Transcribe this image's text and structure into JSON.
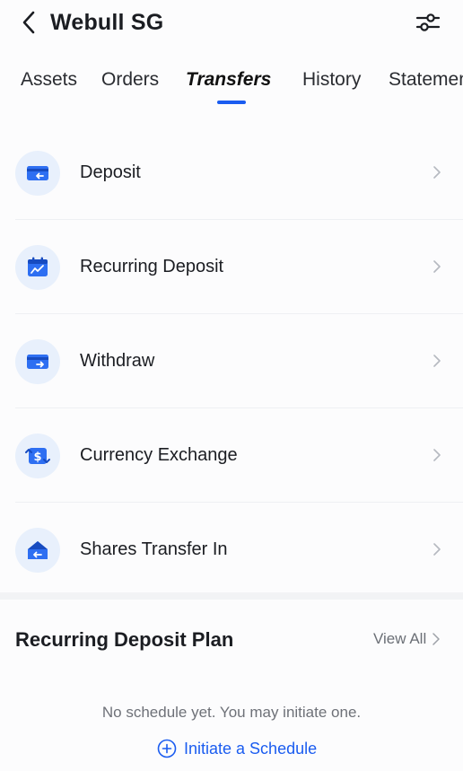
{
  "header": {
    "title": "Webull SG",
    "back_icon": "chevron-left-icon",
    "filter_icon": "sliders-icon"
  },
  "tabs": [
    {
      "label": "Assets",
      "active": false
    },
    {
      "label": "Orders",
      "active": false
    },
    {
      "label": "Transfers",
      "active": true
    },
    {
      "label": "History",
      "active": false
    },
    {
      "label": "Statements",
      "active": false
    }
  ],
  "transfer_items": [
    {
      "label": "Deposit",
      "icon": "deposit-card-icon"
    },
    {
      "label": "Recurring Deposit",
      "icon": "calendar-chart-icon"
    },
    {
      "label": "Withdraw",
      "icon": "withdraw-card-icon"
    },
    {
      "label": "Currency Exchange",
      "icon": "currency-exchange-icon"
    },
    {
      "label": "Shares Transfer In",
      "icon": "house-transfer-icon"
    }
  ],
  "recurring_plan": {
    "title": "Recurring Deposit Plan",
    "view_all": "View All",
    "empty_text": "No schedule yet. You may initiate one.",
    "initiate_label": "Initiate a Schedule"
  },
  "colors": {
    "accent": "#1a5cf0",
    "icon_bg": "#e8f0fc",
    "icon_blue": "#2e6ff2",
    "text_primary": "#1b1d22",
    "text_secondary": "#6e7178"
  }
}
